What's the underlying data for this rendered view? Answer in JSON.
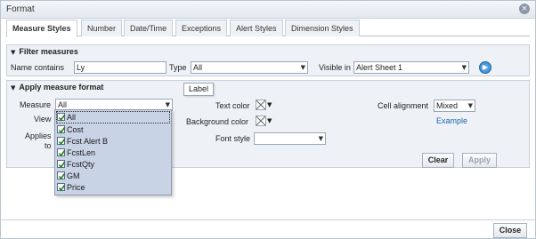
{
  "dialog": {
    "title": "Format",
    "close_label": "Close"
  },
  "tabs": [
    {
      "label": "Measure Styles",
      "active": true
    },
    {
      "label": "Number"
    },
    {
      "label": "Date/Time"
    },
    {
      "label": "Exceptions"
    },
    {
      "label": "Alert Styles"
    },
    {
      "label": "Dimension Styles"
    }
  ],
  "filter": {
    "heading": "Filter measures",
    "name_contains_label": "Name contains",
    "name_contains_value": "Ly",
    "type_label": "Type",
    "type_value": "All",
    "visible_in_label": "Visible in",
    "visible_in_value": "Alert Sheet 1"
  },
  "apply": {
    "heading": "Apply measure format",
    "measure_label": "Measure",
    "measure_value": "All",
    "view_label": "View",
    "applies_label_1": "Applies",
    "applies_label_2": "to",
    "text_color_label": "Text color",
    "bg_color_label": "Background color",
    "font_style_label": "Font style",
    "font_style_value": "",
    "cell_alignment_label": "Cell alignment",
    "cell_alignment_value": "Mixed",
    "example_label": "Example",
    "clear_label": "Clear",
    "apply_label": "Apply",
    "tooltip": "Label"
  },
  "measure_dropdown": [
    {
      "label": "All",
      "checked": true
    },
    {
      "label": "Cost",
      "checked": true
    },
    {
      "label": "Fcst Alert B",
      "checked": true
    },
    {
      "label": "FcstLen",
      "checked": true
    },
    {
      "label": "FcstQty",
      "checked": true
    },
    {
      "label": "GM",
      "checked": true
    },
    {
      "label": "Price",
      "checked": true
    }
  ]
}
